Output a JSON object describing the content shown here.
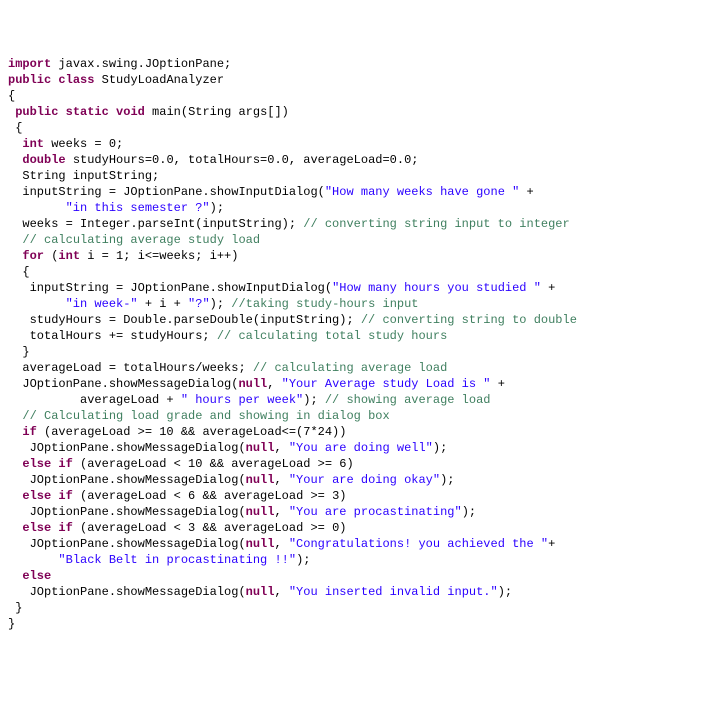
{
  "code": {
    "l01a": "import",
    "l01b": " javax.swing.JOptionPane;",
    "l02": "",
    "l03a": "public",
    "l03b": " ",
    "l03c": "class",
    "l03d": " StudyLoadAnalyzer",
    "l04": "{",
    "l05a": " ",
    "l05b": "public",
    "l05c": " ",
    "l05d": "static",
    "l05e": " ",
    "l05f": "void",
    "l05g": " main(String args[])",
    "l06": " {",
    "l07a": "  ",
    "l07b": "int",
    "l07c": " weeks = 0;",
    "l08a": "  ",
    "l08b": "double",
    "l08c": " studyHours=0.0, totalHours=0.0, averageLoad=0.0;",
    "l09": "  String inputString;",
    "l10": "",
    "l11a": "  inputString = JOptionPane.showInputDialog(",
    "l11b": "\"How many weeks have gone \"",
    "l11c": " +",
    "l12a": "        ",
    "l12b": "\"in this semester ?\"",
    "l12c": ");",
    "l13a": "  weeks = Integer.parseInt(inputString); ",
    "l13b": "// converting string input to integer",
    "l14": "",
    "l15a": "  ",
    "l15b": "// calculating average study load",
    "l16a": "  ",
    "l16b": "for",
    "l16c": " (",
    "l16d": "int",
    "l16e": " i = 1; i<=weeks; i++)",
    "l17": "  {",
    "l18a": "   inputString = JOptionPane.showInputDialog(",
    "l18b": "\"How many hours you studied \"",
    "l18c": " +",
    "l19a": "        ",
    "l19b": "\"in week-\"",
    "l19c": " + i + ",
    "l19d": "\"?\"",
    "l19e": "); ",
    "l19f": "//taking study-hours input",
    "l20a": "   studyHours = Double.parseDouble(inputString); ",
    "l20b": "// converting string to double",
    "l21a": "   totalHours += studyHours; ",
    "l21b": "// calculating total study hours",
    "l22": "  }",
    "l23": "",
    "l24a": "  averageLoad = totalHours/weeks; ",
    "l24b": "// calculating average load",
    "l25a": "  JOptionPane.showMessageDialog(",
    "l25b": "null",
    "l25c": ", ",
    "l25d": "\"Your Average study Load is \"",
    "l25e": " +",
    "l26a": "          averageLoad + ",
    "l26b": "\" hours per week\"",
    "l26c": "); ",
    "l26d": "// showing average load",
    "l27": "",
    "l28a": "  ",
    "l28b": "// Calculating load grade and showing in dialog box",
    "l29a": "  ",
    "l29b": "if",
    "l29c": " (averageLoad >= 10 && averageLoad<=(7*24))",
    "l30a": "   JOptionPane.showMessageDialog(",
    "l30b": "null",
    "l30c": ", ",
    "l30d": "\"You are doing well\"",
    "l30e": ");",
    "l31a": "  ",
    "l31b": "else",
    "l31c": " ",
    "l31d": "if",
    "l31e": " (averageLoad < 10 && averageLoad >= 6)",
    "l32a": "   JOptionPane.showMessageDialog(",
    "l32b": "null",
    "l32c": ", ",
    "l32d": "\"Your are doing okay\"",
    "l32e": ");",
    "l33a": "  ",
    "l33b": "else",
    "l33c": " ",
    "l33d": "if",
    "l33e": " (averageLoad < 6 && averageLoad >= 3)",
    "l34a": "   JOptionPane.showMessageDialog(",
    "l34b": "null",
    "l34c": ", ",
    "l34d": "\"You are procastinating\"",
    "l34e": ");",
    "l35a": "  ",
    "l35b": "else",
    "l35c": " ",
    "l35d": "if",
    "l35e": " (averageLoad < 3 && averageLoad >= 0)",
    "l36a": "   JOptionPane.showMessageDialog(",
    "l36b": "null",
    "l36c": ", ",
    "l36d": "\"Congratulations! you achieved the \"",
    "l36e": "+",
    "l37a": "       ",
    "l37b": "\"Black Belt in procastinating !!\"",
    "l37c": ");",
    "l38a": "  ",
    "l38b": "else",
    "l39a": "   JOptionPane.showMessageDialog(",
    "l39b": "null",
    "l39c": ", ",
    "l39d": "\"You inserted invalid input.\"",
    "l39e": ");",
    "l40": " }",
    "l41": "}"
  }
}
